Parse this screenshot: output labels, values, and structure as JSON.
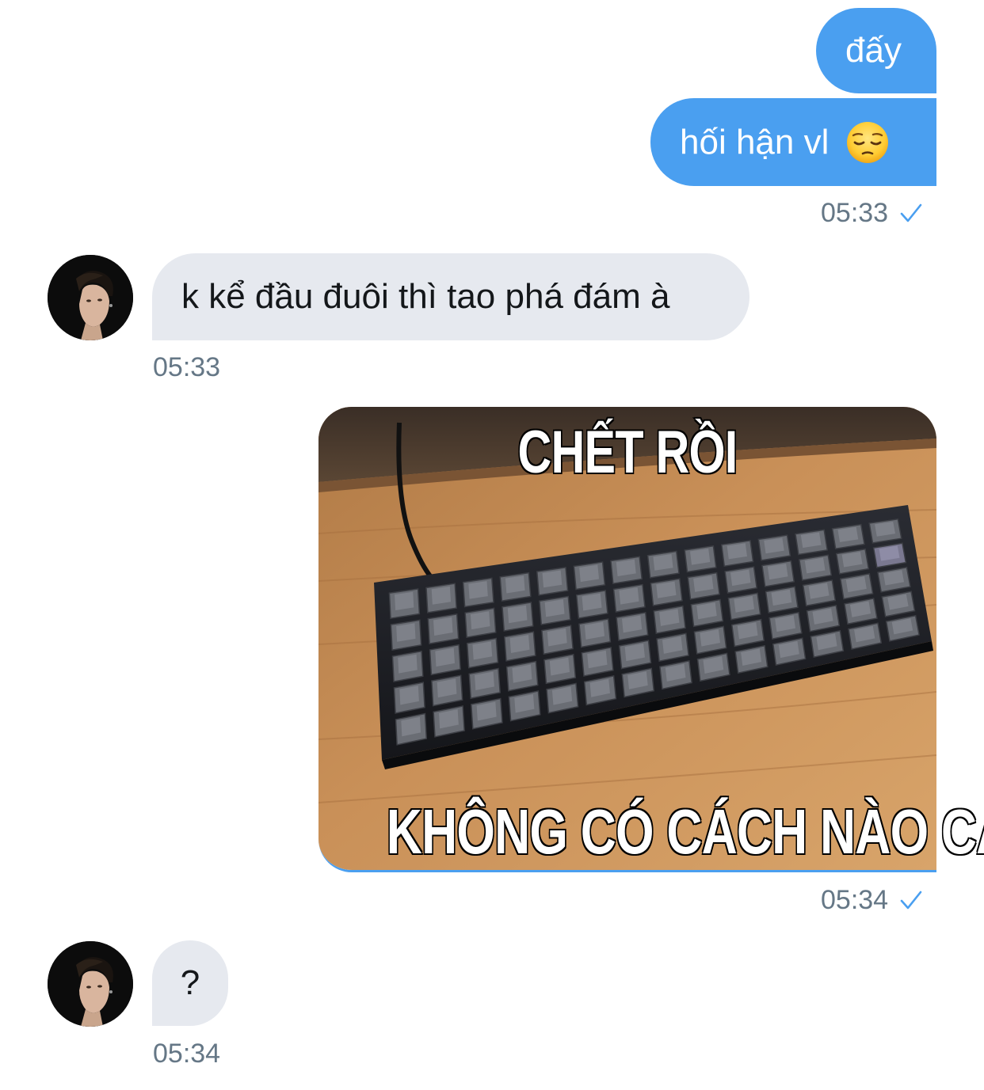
{
  "messages": [
    {
      "direction": "outgoing",
      "text": "đấy"
    },
    {
      "direction": "outgoing",
      "text": "hối hận vl",
      "emoji": "pensive-face-emoji"
    },
    {
      "direction": "incoming",
      "text": "k kể đầu đuôi thì tao phá đám à"
    },
    {
      "direction": "outgoing",
      "type": "image",
      "caption_top": "CHẾT RỒI",
      "caption_bottom": "KHÔNG CÓ CÁCH NÀO CẢ"
    },
    {
      "direction": "incoming",
      "text": "?"
    }
  ],
  "timestamps": {
    "out_1": "05:33",
    "in_1": "05:33",
    "out_2": "05:34",
    "in_2": "05:34"
  },
  "icons": {
    "read_check": "checkmark-icon",
    "avatar": "contact-avatar"
  },
  "colors": {
    "outgoing_bubble": "#4a9ff0",
    "incoming_bubble": "#e6e9ef",
    "timestamp": "#657786",
    "check": "#4a9ff0"
  }
}
